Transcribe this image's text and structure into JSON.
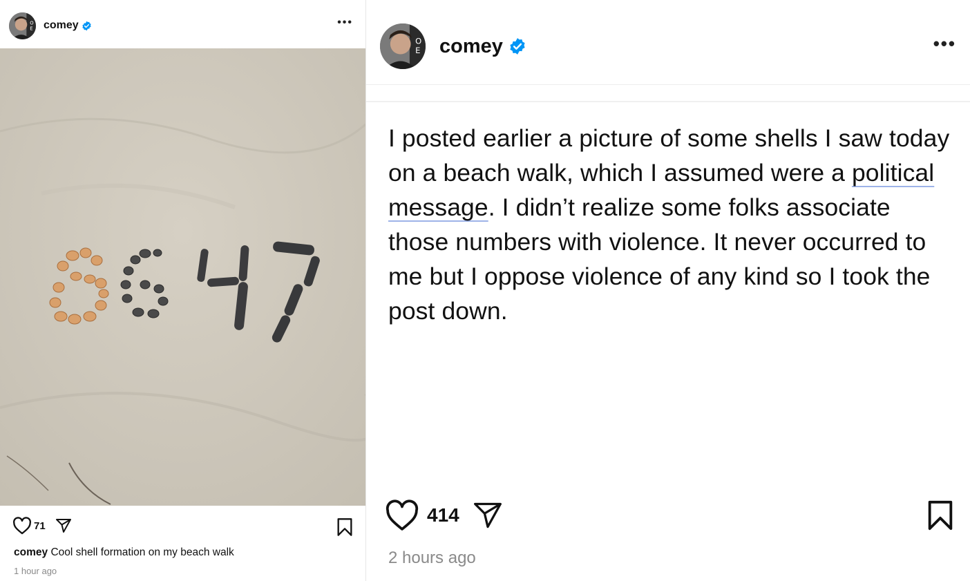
{
  "colors": {
    "text": "#111111",
    "secondary_text": "#8a8a8a",
    "verified": "#0095f6",
    "sand": "#cfc9bd",
    "underline": "#9db3e8"
  },
  "left_post": {
    "username": "comey",
    "verified": true,
    "more_icon": "more-horizontal-icon",
    "image_alt": "Shells and stones arranged in the sand spelling 8647",
    "image_text": "8647",
    "like_count": "71",
    "caption_user": "comey",
    "caption_text": "Cool shell formation on my beach walk",
    "timestamp": "1 hour ago"
  },
  "right_post": {
    "username": "comey",
    "verified": true,
    "more_icon": "more-horizontal-icon",
    "text_part1": "I posted earlier a picture of some shells I saw today on a beach walk, which I assumed were a ",
    "text_underlined1": "political",
    "text_space": " ",
    "text_underlined2": "message",
    "text_part2": ". I didn’t realize some folks associate those numbers with violence. It never occurred to me but I oppose violence of any kind so I took the post down.",
    "like_count": "414",
    "timestamp": "2 hours ago"
  }
}
